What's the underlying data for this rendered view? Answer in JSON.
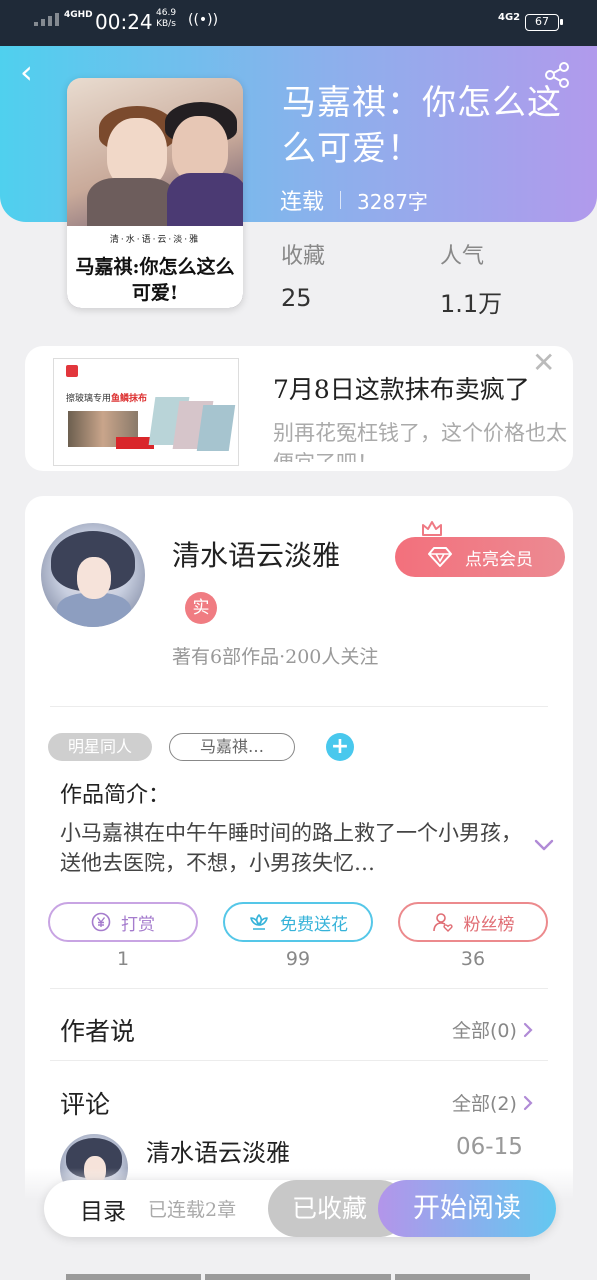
{
  "status_bar": {
    "network": "4GHD",
    "time": "00:24",
    "speed_value": "46.9",
    "speed_unit": "KB/s",
    "network2": "4G2",
    "battery": "67"
  },
  "book": {
    "title": "马嘉祺：你怎么这么可爱！",
    "status": "连载",
    "word_count": "3287字",
    "cover_small_text": "清·水·语·云·淡·雅",
    "cover_title": "马嘉祺:你怎么这么可爱!",
    "stats": [
      {
        "label": "收藏",
        "value": "25"
      },
      {
        "label": "人气",
        "value": "1.1万"
      }
    ]
  },
  "ad": {
    "title": "7月8日这款抹布卖疯了",
    "description": "别再花冤枉钱了，这个价格也太便宜了吧！",
    "image_header": "擦玻璃专用",
    "image_header_highlight": "鱼鳞抹布"
  },
  "author": {
    "name": "清水语云淡雅",
    "badge": "实",
    "stats": "著有6部作品·200人关注",
    "vip_label": "点亮会员"
  },
  "tags": [
    "明星同人",
    "马嘉祺…"
  ],
  "intro": {
    "label": "作品简介：",
    "text": "小马嘉祺在中午午睡时间的路上救了一个小男孩，送他去医院，不想，小男孩失忆…"
  },
  "actions": [
    {
      "label": "打赏",
      "icon": "yen-icon",
      "count": "1"
    },
    {
      "label": "免费送花",
      "icon": "flower-icon",
      "count": "99"
    },
    {
      "label": "粉丝榜",
      "icon": "user-heart-icon",
      "count": "36"
    }
  ],
  "author_says": {
    "title": "作者说",
    "more": "全部(0)"
  },
  "comments": {
    "title": "评论",
    "more": "全部(2)",
    "items": [
      {
        "name": "清水语云淡雅",
        "date": "06-15"
      }
    ]
  },
  "bottom_bar": {
    "toc_label": "目录",
    "toc_count": "已连载2章",
    "collected_label": "已收藏",
    "read_label": "开始阅读"
  },
  "colors": {
    "accent_cyan": "#4fd0ee",
    "accent_purple": "#b19aec",
    "vip_red": "#f3707c"
  }
}
